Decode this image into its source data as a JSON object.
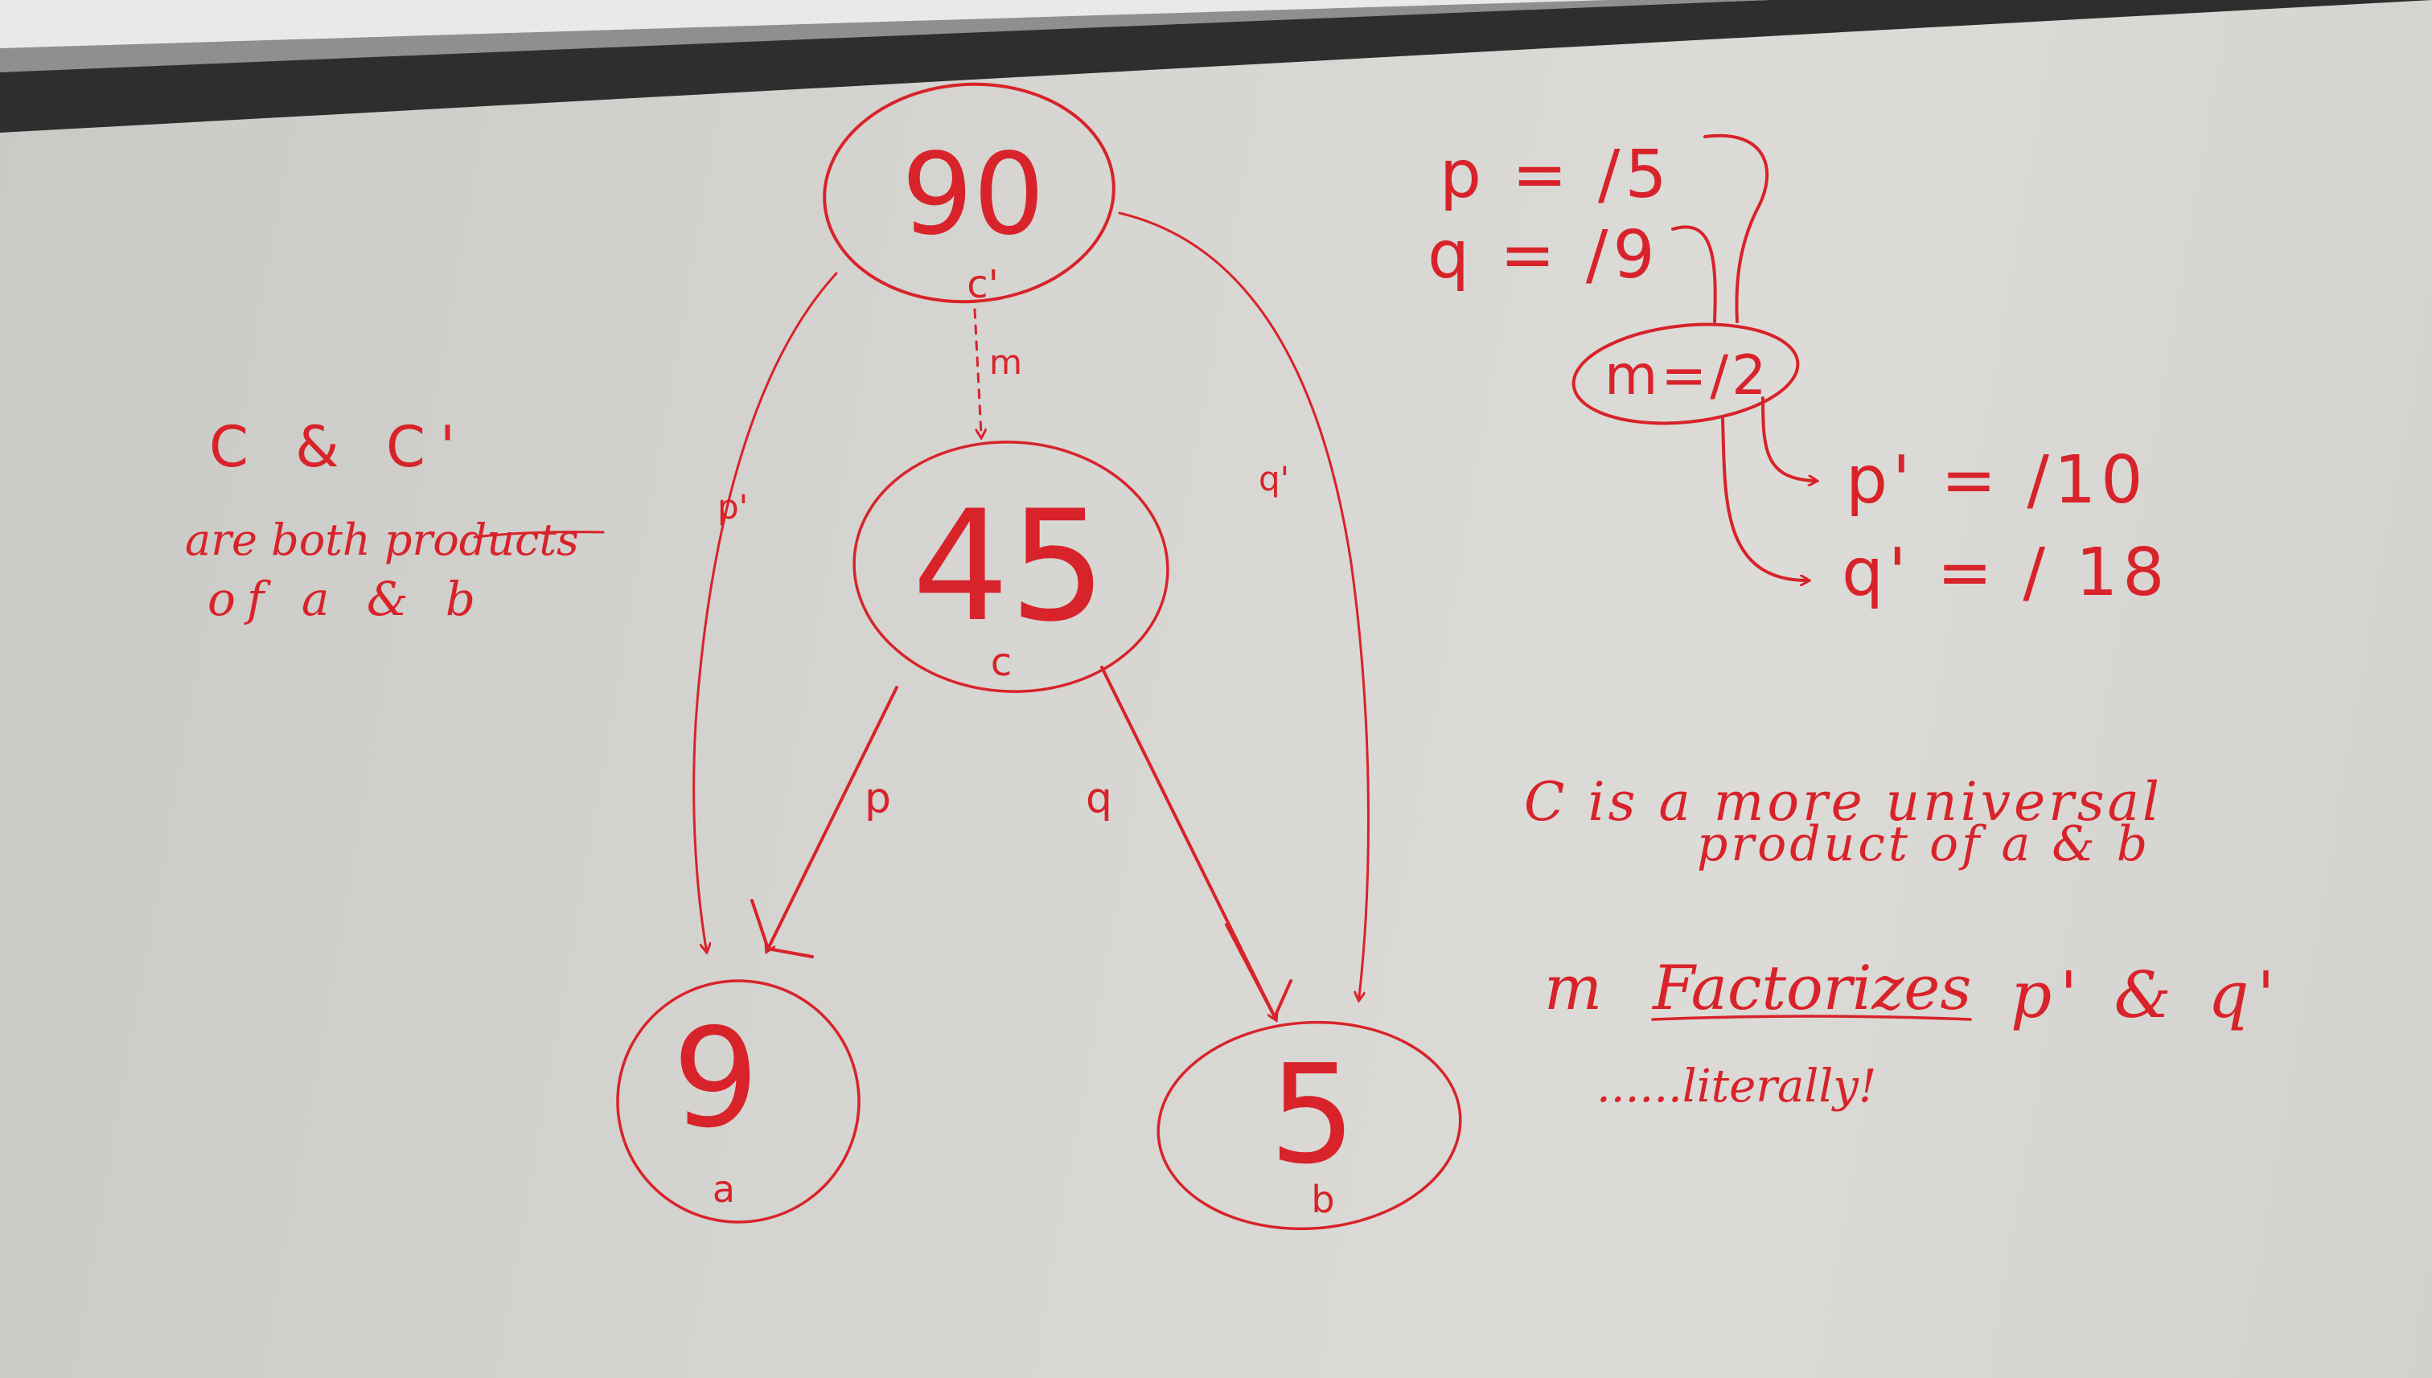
{
  "ink_color": "#d8232a",
  "board_color": "#d6d5d1",
  "nodes": {
    "top": {
      "value": "90",
      "label": "c'"
    },
    "middle": {
      "value": "45",
      "label": "c"
    },
    "left": {
      "value": "9",
      "label": "a"
    },
    "right": {
      "value": "5",
      "label": "b"
    }
  },
  "arrows": {
    "m": "m",
    "p_prime": "p'",
    "q_prime": "q'",
    "p": "p",
    "q": "q"
  },
  "left_note": {
    "line1": "C & C'",
    "line2": "are both products",
    "line3": "of a & b"
  },
  "right_top": {
    "p_def": "p = /5",
    "q_def": "q = /9",
    "m_def": "m=/2",
    "p_prime_def": "p' = /10",
    "q_prime_def": "q' = / 18"
  },
  "right_bottom": {
    "line1": "C is a more universal",
    "line2": "product of a & b",
    "line3_prefix": "m",
    "line3_word": "Factorizes",
    "line3_suffix": "p' & q'",
    "line4": "......literally!"
  }
}
